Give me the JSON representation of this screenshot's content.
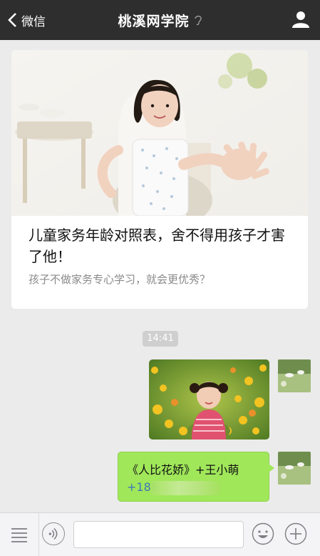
{
  "nav": {
    "back_label": "微信",
    "title": "桃溪网学院"
  },
  "article": {
    "title": "儿童家务年龄对照表，舍不得用孩子才害了他！",
    "description": "孩子不做家务专心学习，就会更优秀？"
  },
  "chat": {
    "time": "14:41",
    "text_message": {
      "name_line": "《人比花娇》+王小萌",
      "phone_prefix": "+186"
    }
  },
  "colors": {
    "nav_bg": "#2e2e2e",
    "bubble_green": "#a0e75a",
    "phone_link": "#3f78b8"
  },
  "icons": [
    "chevron-left-icon",
    "ear-icon",
    "person-icon",
    "keyboard-menu-icon",
    "voice-icon",
    "emoji-icon",
    "plus-icon"
  ]
}
